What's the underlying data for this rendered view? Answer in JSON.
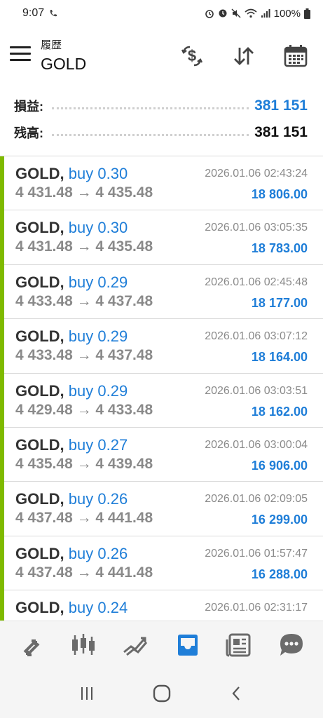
{
  "status_bar": {
    "time": "9:07",
    "battery": "100%"
  },
  "header": {
    "subtitle": "履歴",
    "title": "GOLD",
    "icons": [
      "currency-exchange-icon",
      "sort-icon",
      "calendar-icon"
    ]
  },
  "summary": {
    "profit_label": "損益:",
    "profit_value": "381 151",
    "balance_label": "残高:",
    "balance_value": "381 151",
    "profit_color": "#1f7ed8"
  },
  "trades": [
    {
      "symbol": "GOLD,",
      "side": "buy 0.30",
      "prices": "4 431.48 → 4 435.48",
      "time": "2026.01.06 02:43:24",
      "profit": "18 806.00"
    },
    {
      "symbol": "GOLD,",
      "side": "buy 0.30",
      "prices": "4 431.48 → 4 435.48",
      "time": "2026.01.06 03:05:35",
      "profit": "18 783.00"
    },
    {
      "symbol": "GOLD,",
      "side": "buy 0.29",
      "prices": "4 433.48 → 4 437.48",
      "time": "2026.01.06 02:45:48",
      "profit": "18 177.00"
    },
    {
      "symbol": "GOLD,",
      "side": "buy 0.29",
      "prices": "4 433.48 → 4 437.48",
      "time": "2026.01.06 03:07:12",
      "profit": "18 164.00"
    },
    {
      "symbol": "GOLD,",
      "side": "buy 0.29",
      "prices": "4 429.48 → 4 433.48",
      "time": "2026.01.06 03:03:51",
      "profit": "18 162.00"
    },
    {
      "symbol": "GOLD,",
      "side": "buy 0.27",
      "prices": "4 435.48 → 4 439.48",
      "time": "2026.01.06 03:00:04",
      "profit": "16 906.00"
    },
    {
      "symbol": "GOLD,",
      "side": "buy 0.26",
      "prices": "4 437.48 → 4 441.48",
      "time": "2026.01.06 02:09:05",
      "profit": "16 299.00"
    },
    {
      "symbol": "GOLD,",
      "side": "buy 0.26",
      "prices": "4 437.48 → 4 441.48",
      "time": "2026.01.06 01:57:47",
      "profit": "16 288.00"
    },
    {
      "symbol": "GOLD,",
      "side": "buy 0.24",
      "prices": "",
      "time": "2026.01.06 02:31:17",
      "profit": ""
    }
  ],
  "bottom_nav": {
    "items": [
      "quotes-icon",
      "chart-icon",
      "trade-icon",
      "history-icon",
      "news-icon",
      "messages-icon"
    ],
    "active": "history-icon",
    "active_color": "#1f7ed8",
    "inactive_color": "#6b6b6b"
  },
  "system_nav": [
    "recent-apps-icon",
    "home-icon",
    "back-icon"
  ],
  "colors": {
    "buy_bar": "#7fba00",
    "accent": "#1f7ed8"
  }
}
